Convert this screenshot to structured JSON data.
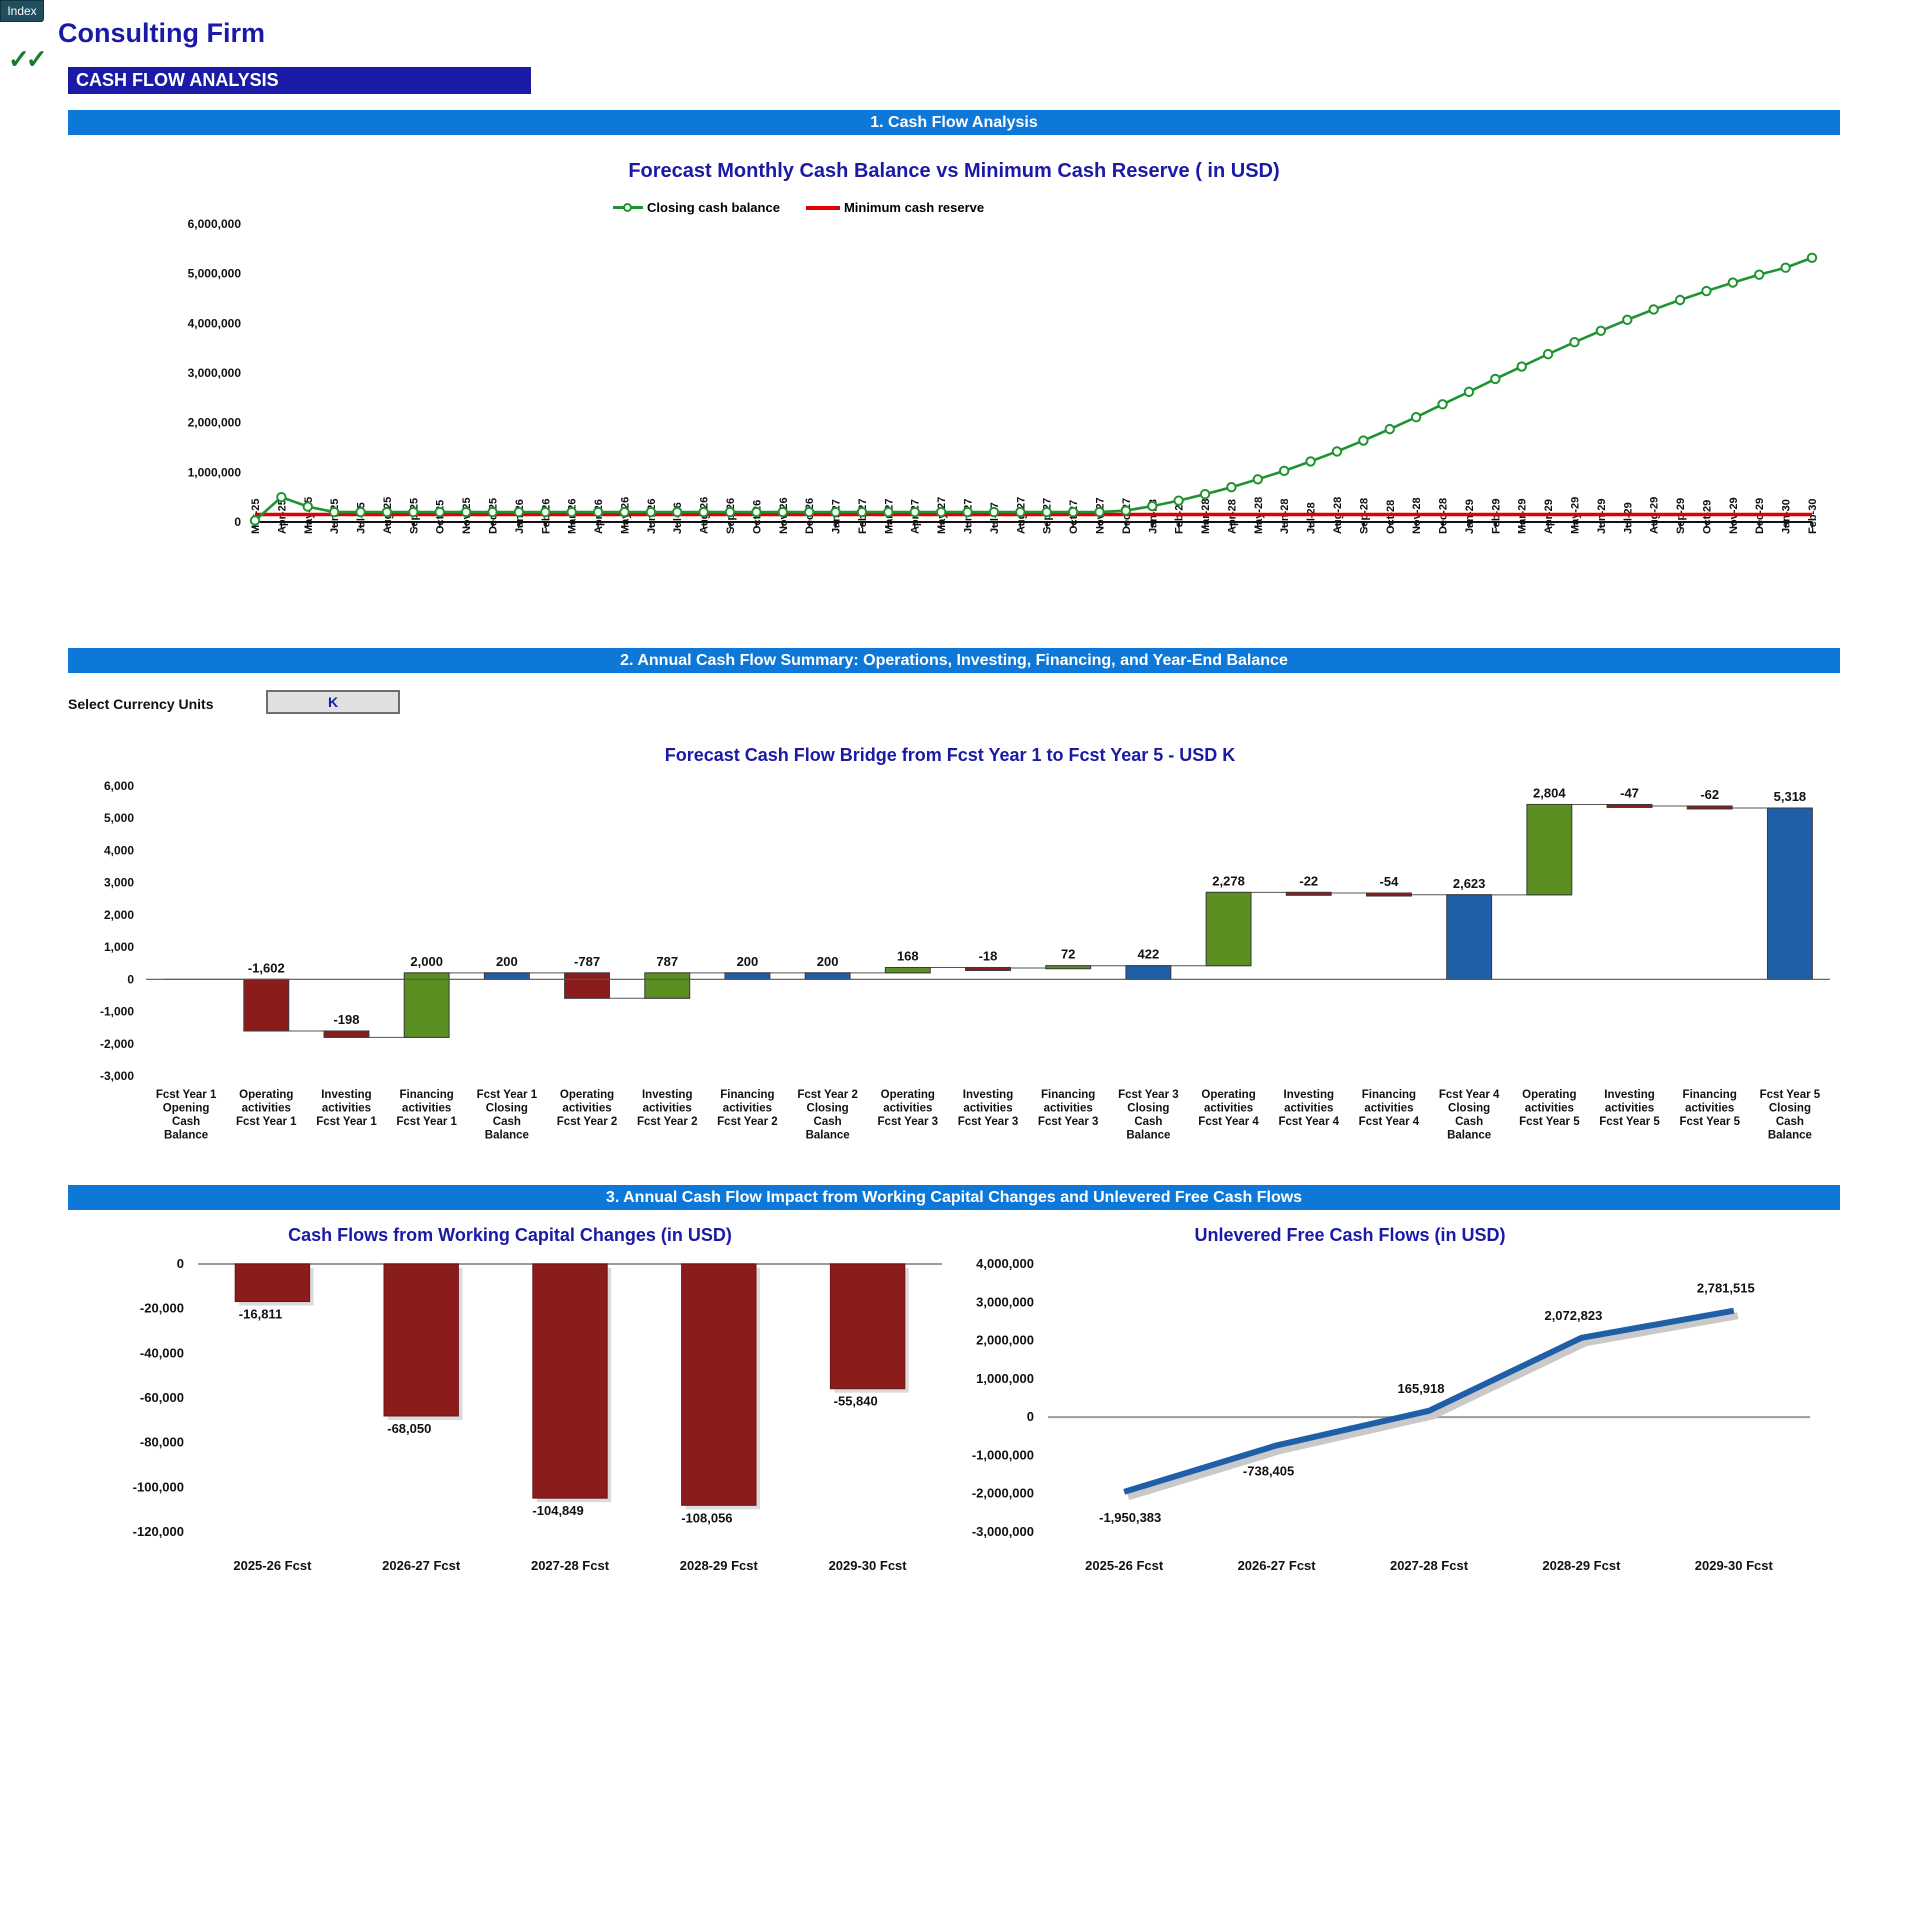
{
  "header": {
    "index_tab": "Index",
    "firm_name": "Consulting Firm",
    "checkmarks": "✓✓",
    "page_banner": "CASH FLOW ANALYSIS"
  },
  "sections": {
    "s1": "1. Cash Flow Analysis",
    "s2": "2. Annual Cash Flow Summary: Operations, Investing, Financing, and Year-End Balance",
    "s3": "3. Annual Cash Flow Impact from Working Capital Changes and Unlevered Free Cash Flows"
  },
  "currency_selector": {
    "label": "Select Currency Units",
    "value": "K"
  },
  "chart_data": [
    {
      "id": "monthly_cash_balance",
      "type": "line",
      "title": "Forecast Monthly Cash Balance vs Minimum Cash Reserve ( in USD)",
      "xlabel": "",
      "ylabel": "",
      "ylim": [
        0,
        6000000
      ],
      "ytick_labels": [
        "6,000,000",
        "5,000,000",
        "4,000,000",
        "3,000,000",
        "2,000,000",
        "1,000,000",
        "0"
      ],
      "yticks": [
        6000000,
        5000000,
        4000000,
        3000000,
        2000000,
        1000000,
        0
      ],
      "grid": false,
      "legend": [
        "Closing cash balance",
        "Minimum cash reserve"
      ],
      "legend_position": "top",
      "colors": {
        "closing_cash_balance": "#1e9431",
        "minimum_cash_reserve": "#e00000"
      },
      "categories": [
        "Mar-25",
        "Apr-25",
        "May-25",
        "Jun-25",
        "Jul-25",
        "Aug-25",
        "Sep-25",
        "Oct-25",
        "Nov-25",
        "Dec-25",
        "Jan-26",
        "Feb-26",
        "Mar-26",
        "Apr-26",
        "May-26",
        "Jun-26",
        "Jul-26",
        "Aug-26",
        "Sep-26",
        "Oct-26",
        "Nov-26",
        "Dec-26",
        "Jan-27",
        "Feb-27",
        "Mar-27",
        "Apr-27",
        "May-27",
        "Jun-27",
        "Jul-27",
        "Aug-27",
        "Sep-27",
        "Oct-27",
        "Nov-27",
        "Dec-27",
        "Jan-28",
        "Feb-28",
        "Mar-28",
        "Apr-28",
        "May-28",
        "Jun-28",
        "Jul-28",
        "Aug-28",
        "Sep-28",
        "Oct-28",
        "Nov-28",
        "Dec-28",
        "Jan-29",
        "Feb-29",
        "Mar-29",
        "Apr-29",
        "May-29",
        "Jun-29",
        "Jul-29",
        "Aug-29",
        "Sep-29",
        "Oct-29",
        "Nov-29",
        "Dec-29",
        "Jan-30",
        "Feb-30"
      ],
      "series": [
        {
          "name": "Closing cash balance",
          "values": [
            30000,
            500000,
            310000,
            200000,
            200000,
            200000,
            200000,
            200000,
            200000,
            200000,
            200000,
            200000,
            200000,
            200000,
            200000,
            200000,
            200000,
            200000,
            200000,
            200000,
            200000,
            200000,
            200000,
            200000,
            200000,
            200000,
            200000,
            200000,
            200000,
            200000,
            200000,
            200000,
            200000,
            230000,
            320000,
            430000,
            560000,
            700000,
            860000,
            1030000,
            1220000,
            1420000,
            1640000,
            1870000,
            2110000,
            2370000,
            2620000,
            2880000,
            3130000,
            3380000,
            3620000,
            3850000,
            4070000,
            4280000,
            4470000,
            4650000,
            4820000,
            4980000,
            5120000,
            5320000
          ]
        },
        {
          "name": "Minimum cash reserve",
          "values": [
            150000,
            150000,
            150000,
            150000,
            150000,
            150000,
            150000,
            150000,
            150000,
            150000,
            150000,
            150000,
            150000,
            150000,
            150000,
            150000,
            150000,
            150000,
            150000,
            150000,
            150000,
            150000,
            150000,
            150000,
            150000,
            150000,
            150000,
            150000,
            150000,
            150000,
            150000,
            150000,
            150000,
            150000,
            150000,
            150000,
            150000,
            150000,
            150000,
            150000,
            150000,
            150000,
            150000,
            150000,
            150000,
            150000,
            150000,
            150000,
            150000,
            150000,
            150000,
            150000,
            150000,
            150000,
            150000,
            150000,
            150000,
            150000,
            150000,
            150000
          ]
        }
      ]
    },
    {
      "id": "cash_flow_bridge",
      "type": "bar",
      "subtype": "waterfall",
      "title": "Forecast Cash Flow Bridge from Fcst Year 1 to Fcst Year 5 - USD K",
      "xlabel": "",
      "ylabel": "",
      "ylim": [
        -3000,
        6000
      ],
      "ytick_labels": [
        "6,000",
        "5,000",
        "4,000",
        "3,000",
        "2,000",
        "1,000",
        "0",
        "-1,000",
        "-2,000",
        "-3,000"
      ],
      "yticks": [
        6000,
        5000,
        4000,
        3000,
        2000,
        1000,
        0,
        -1000,
        -2000,
        -3000
      ],
      "grid": false,
      "colors": {
        "increase": "#5b8f22",
        "decrease": "#8a1c1c",
        "total": "#1f5fa8"
      },
      "categories": [
        "Fcst Year 1 Opening Cash Balance",
        "Operating activities Fcst Year 1",
        "Investing activities Fcst Year 1",
        "Financing activities Fcst Year 1",
        "Fcst Year 1 Closing Cash Balance",
        "Operating activities Fcst Year 2",
        "Investing activities Fcst Year 2",
        "Financing activities Fcst Year 2",
        "Fcst Year 2 Closing Cash Balance",
        "Operating activities Fcst Year 3",
        "Investing activities Fcst Year 3",
        "Financing activities Fcst Year 3",
        "Fcst Year 3 Closing Cash Balance",
        "Operating activities Fcst Year 4",
        "Investing activities Fcst Year 4",
        "Financing activities Fcst Year 4",
        "Fcst Year 4 Closing Cash Balance",
        "Operating activities Fcst Year 5",
        "Investing activities Fcst Year 5",
        "Financing activities Fcst Year 5",
        "Fcst Year 5 Closing Cash Balance"
      ],
      "labels": [
        "",
        "-1,602",
        "-198",
        "2,000",
        "200",
        "-787",
        "787",
        "200",
        "200",
        "168",
        "-18",
        "72",
        "422",
        "2,278",
        "-22",
        "-54",
        "2,623",
        "2,804",
        "-47",
        "-62",
        "5,318"
      ],
      "values": [
        0,
        -1602,
        -198,
        2000,
        200,
        -787,
        787,
        200,
        200,
        168,
        -18,
        72,
        422,
        2278,
        -22,
        -54,
        2623,
        2804,
        -47,
        -62,
        5318
      ],
      "kinds": [
        "total",
        "decrease",
        "decrease",
        "increase",
        "total",
        "decrease",
        "increase",
        "total",
        "total",
        "increase",
        "decrease",
        "increase",
        "total",
        "increase",
        "decrease",
        "decrease",
        "total",
        "increase",
        "decrease",
        "decrease",
        "total"
      ]
    },
    {
      "id": "working_capital_changes",
      "type": "bar",
      "title": "Cash Flows from Working Capital Changes (in USD)",
      "xlabel": "",
      "ylabel": "",
      "ylim": [
        -120000,
        0
      ],
      "ytick_labels": [
        "0",
        "-20,000",
        "-40,000",
        "-60,000",
        "-80,000",
        "-100,000",
        "-120,000"
      ],
      "yticks": [
        0,
        -20000,
        -40000,
        -60000,
        -80000,
        -100000,
        -120000
      ],
      "grid": false,
      "color": "#8a1c1c",
      "categories": [
        "2025-26 Fcst",
        "2026-27 Fcst",
        "2027-28 Fcst",
        "2028-29 Fcst",
        "2029-30 Fcst"
      ],
      "values": [
        -16811,
        -68050,
        -104849,
        -108056,
        -55840
      ],
      "labels": [
        "-16,811",
        "-68,050",
        "-104,849",
        "-108,056",
        "-55,840"
      ]
    },
    {
      "id": "unlevered_free_cash_flows",
      "type": "line",
      "title": "Unlevered Free Cash Flows (in USD)",
      "xlabel": "",
      "ylabel": "",
      "ylim": [
        -3000000,
        4000000
      ],
      "ytick_labels": [
        "4,000,000",
        "3,000,000",
        "2,000,000",
        "1,000,000",
        "0",
        "-1,000,000",
        "-2,000,000",
        "-3,000,000"
      ],
      "yticks": [
        4000000,
        3000000,
        2000000,
        1000000,
        0,
        -1000000,
        -2000000,
        -3000000
      ],
      "grid": false,
      "color": "#1f5fa8",
      "categories": [
        "2025-26 Fcst",
        "2026-27 Fcst",
        "2027-28 Fcst",
        "2028-29 Fcst",
        "2029-30 Fcst"
      ],
      "values": [
        -1950383,
        -738405,
        165918,
        2072823,
        2781515
      ],
      "labels": [
        "-1,950,383",
        "-738,405",
        "165,918",
        "2,072,823",
        "2,781,515"
      ]
    }
  ]
}
